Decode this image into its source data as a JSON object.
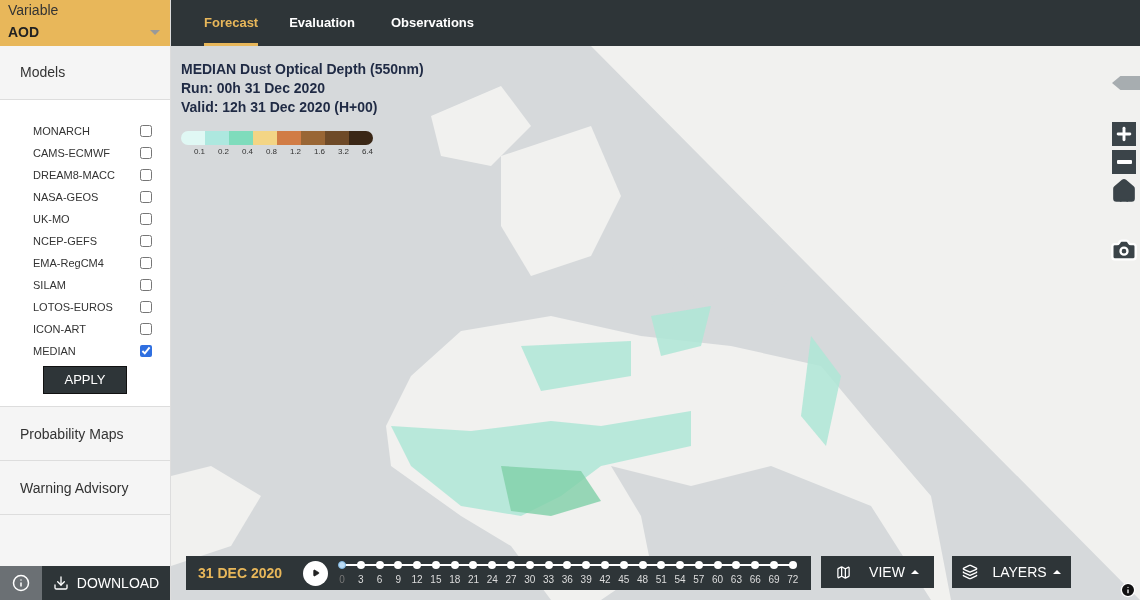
{
  "variable": {
    "label": "Variable",
    "value": "AOD"
  },
  "tabs": [
    {
      "label": "Forecast",
      "selected": true
    },
    {
      "label": "Evaluation",
      "selected": false
    },
    {
      "label": "Observations",
      "selected": false
    }
  ],
  "models_section": {
    "title": "Models",
    "items": [
      {
        "name": "MONARCH",
        "checked": false
      },
      {
        "name": "CAMS-ECMWF",
        "checked": false
      },
      {
        "name": "DREAM8-MACC",
        "checked": false
      },
      {
        "name": "NASA-GEOS",
        "checked": false
      },
      {
        "name": "UK-MO",
        "checked": false
      },
      {
        "name": "NCEP-GEFS",
        "checked": false
      },
      {
        "name": "EMA-RegCM4",
        "checked": false
      },
      {
        "name": "SILAM",
        "checked": false
      },
      {
        "name": "LOTOS-EUROS",
        "checked": false
      },
      {
        "name": "ICON-ART",
        "checked": false
      },
      {
        "name": "MEDIAN",
        "checked": true
      }
    ],
    "apply_button": "APPLY"
  },
  "other_sections": [
    {
      "title": "Probability Maps"
    },
    {
      "title": "Warning Advisory"
    }
  ],
  "download_button": "DOWNLOAD",
  "map": {
    "title_lines": [
      "MEDIAN Dust Optical Depth (550nm)",
      "Run: 00h 31 Dec 2020",
      "Valid: 12h 31 Dec 2020 (H+00)"
    ],
    "legend": [
      {
        "color": "#e0f8f4",
        "label": "0.1"
      },
      {
        "color": "#ade8df",
        "label": "0.2"
      },
      {
        "color": "#7fdcbc",
        "label": "0.4"
      },
      {
        "color": "#f3d585",
        "label": "0.8"
      },
      {
        "color": "#d17c45",
        "label": "1.2"
      },
      {
        "color": "#996635",
        "label": "1.6"
      },
      {
        "color": "#6e4a28",
        "label": "3.2"
      },
      {
        "color": "#3a2716",
        "label": "6.4"
      }
    ]
  },
  "timeline": {
    "date": "31 DEC 2020",
    "steps": [
      {
        "label": "0",
        "selected": true
      },
      {
        "label": "3",
        "selected": false
      },
      {
        "label": "6",
        "selected": false
      },
      {
        "label": "9",
        "selected": false
      },
      {
        "label": "12",
        "selected": false
      },
      {
        "label": "15",
        "selected": false
      },
      {
        "label": "18",
        "selected": false
      },
      {
        "label": "21",
        "selected": false
      },
      {
        "label": "24",
        "selected": false
      },
      {
        "label": "27",
        "selected": false
      },
      {
        "label": "30",
        "selected": false
      },
      {
        "label": "33",
        "selected": false
      },
      {
        "label": "36",
        "selected": false
      },
      {
        "label": "39",
        "selected": false
      },
      {
        "label": "42",
        "selected": false
      },
      {
        "label": "45",
        "selected": false
      },
      {
        "label": "48",
        "selected": false
      },
      {
        "label": "51",
        "selected": false
      },
      {
        "label": "54",
        "selected": false
      },
      {
        "label": "57",
        "selected": false
      },
      {
        "label": "60",
        "selected": false
      },
      {
        "label": "63",
        "selected": false
      },
      {
        "label": "66",
        "selected": false
      },
      {
        "label": "69",
        "selected": false
      },
      {
        "label": "72",
        "selected": false
      }
    ]
  },
  "view_button": "VIEW",
  "layers_button": "LAYERS"
}
